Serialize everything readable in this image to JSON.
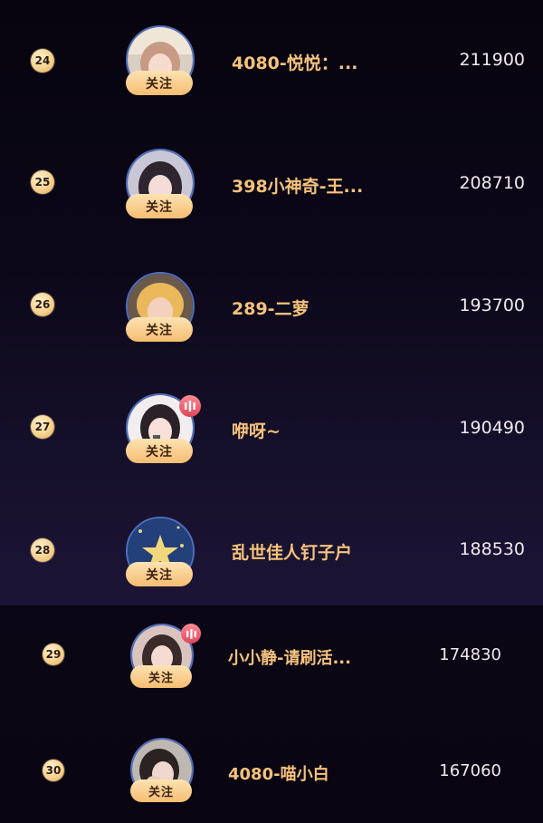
{
  "rows": [
    {
      "rank": "24",
      "name": "4080-悦悦：...",
      "score": "211900",
      "follow": "关注",
      "live": false,
      "avatar": "avatar-pink-hair"
    },
    {
      "rank": "25",
      "name": "398小神奇-王...",
      "score": "208710",
      "follow": "关注",
      "live": false,
      "avatar": "avatar-dark-hair"
    },
    {
      "rank": "26",
      "name": "289-二萝",
      "score": "193700",
      "follow": "关注",
      "live": false,
      "avatar": "avatar-blonde"
    },
    {
      "rank": "27",
      "name": "咿呀~",
      "score": "190490",
      "follow": "关注",
      "live": true,
      "avatar": "avatar-singer"
    },
    {
      "rank": "28",
      "name": "乱世佳人钉子户",
      "score": "188530",
      "follow": "关注",
      "live": false,
      "avatar": "avatar-star-night"
    },
    {
      "rank": "29",
      "name": "小小静-请刷活...",
      "score": "174830",
      "follow": "关注",
      "live": true,
      "avatar": "avatar-long-hair"
    },
    {
      "rank": "30",
      "name": "4080-喵小白",
      "score": "167060",
      "follow": "关注",
      "live": false,
      "avatar": "avatar-hand-face"
    }
  ],
  "colors": {
    "accent_name": "#f6c27b",
    "follow_button": "#f6bd71",
    "rank_badge": "#f7d18f",
    "live_badge": "#e0455a",
    "score_text": "#f1e9f0"
  }
}
